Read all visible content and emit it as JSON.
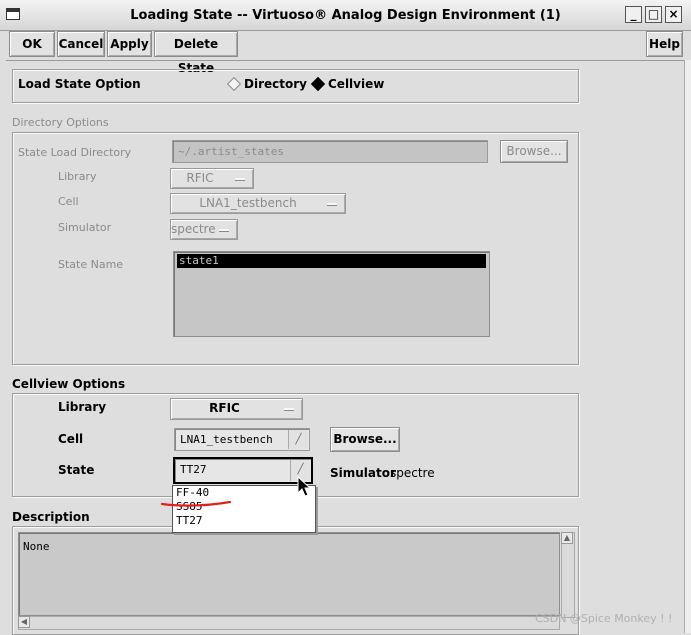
{
  "window": {
    "title": "Loading State -- Virtuoso® Analog Design Environment (1)",
    "min_glyph": "_",
    "max_glyph": "□",
    "close_glyph": "×"
  },
  "toolbar": {
    "ok_label": "OK",
    "cancel_label": "Cancel",
    "apply_label": "Apply",
    "delete_state_label": "Delete State",
    "help_label": "Help"
  },
  "load_option": {
    "label": "Load State Option",
    "directory_label": "Directory",
    "cellview_label": "Cellview",
    "selected": "Cellview"
  },
  "directory_options": {
    "heading": "Directory Options",
    "state_load_directory_label": "State Load Directory",
    "state_load_directory_value": "~/.artist_states",
    "browse_label": "Browse...",
    "library_label": "Library",
    "library_value": "RFIC",
    "cell_label": "Cell",
    "cell_value": "LNA1_testbench",
    "simulator_label": "Simulator",
    "simulator_value": "spectre",
    "state_name_label": "State Name",
    "state_names": [
      "state1"
    ]
  },
  "cellview_options": {
    "heading": "Cellview Options",
    "library_label": "Library",
    "library_value": "RFIC",
    "cell_label": "Cell",
    "cell_value": "LNA1_testbench",
    "browse_label": "Browse...",
    "state_label": "State",
    "state_value": "TT27",
    "simulator_label": "Simulator",
    "simulator_value": "spectre",
    "state_options": [
      "FF-40",
      "SS85",
      "TT27"
    ]
  },
  "description": {
    "heading": "Description",
    "text": "None"
  },
  "watermark": "CSDN @Spice Monkey ! !",
  "colors": {
    "annotation_underline": "#e0201c",
    "window_bg": "#dedede"
  }
}
